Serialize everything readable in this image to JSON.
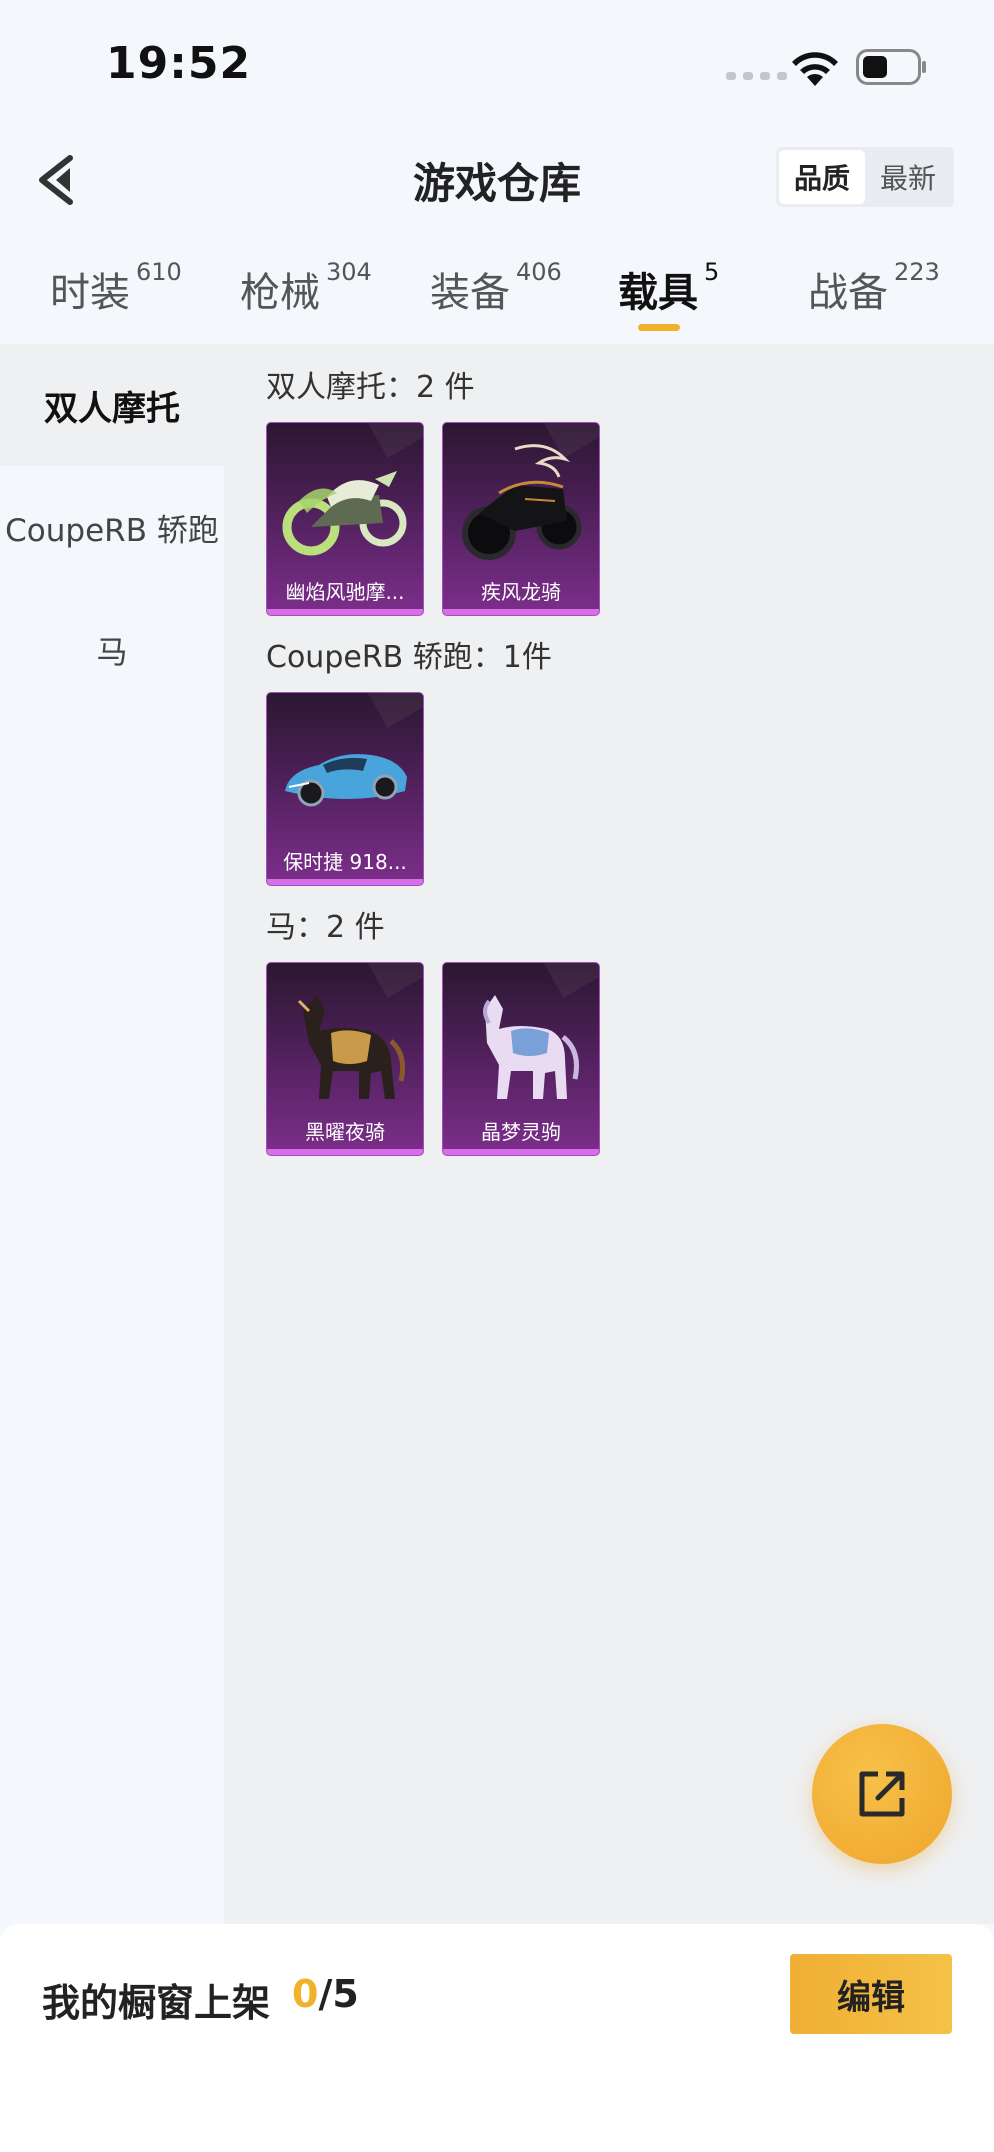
{
  "status_bar": {
    "time": "19:52"
  },
  "header": {
    "title": "游戏仓库",
    "sort_options": [
      "品质",
      "最新"
    ],
    "sort_selected": "品质"
  },
  "tabs": [
    {
      "label": "时装",
      "count": "610"
    },
    {
      "label": "枪械",
      "count": "304"
    },
    {
      "label": "装备",
      "count": "406"
    },
    {
      "label": "载具",
      "count": "5",
      "active": true
    },
    {
      "label": "战备",
      "count": "223"
    }
  ],
  "sidebar": {
    "items": [
      {
        "label": "双人摩托",
        "active": true
      },
      {
        "label": "CoupeRB 轿跑"
      },
      {
        "label": "马"
      }
    ]
  },
  "sections": [
    {
      "title": "双人摩托：2 件",
      "items": [
        {
          "name": "幽焰风驰摩...",
          "icon": "green-flame-motorcycle"
        },
        {
          "name": "疾风龙骑",
          "icon": "black-dragon-motorcycle"
        }
      ]
    },
    {
      "title": "CoupeRB 轿跑：1件",
      "items": [
        {
          "name": "保时捷 918...",
          "icon": "blue-sports-car"
        }
      ]
    },
    {
      "title": "马：2 件",
      "items": [
        {
          "name": "黑曜夜骑",
          "icon": "dark-gold-horse"
        },
        {
          "name": "晶梦灵驹",
          "icon": "crystal-white-horse"
        }
      ]
    }
  ],
  "fab": {
    "icon": "share-external-icon"
  },
  "footer": {
    "label": "我的橱窗上架",
    "current": "0",
    "separator": "/",
    "total": "5",
    "edit_label": "编辑"
  },
  "colors": {
    "accent": "#f0b22a",
    "card_purple": "#7d2e8c",
    "card_rim": "#d66fe8",
    "background": "#f4f7fb",
    "panel": "#eff0f2"
  }
}
